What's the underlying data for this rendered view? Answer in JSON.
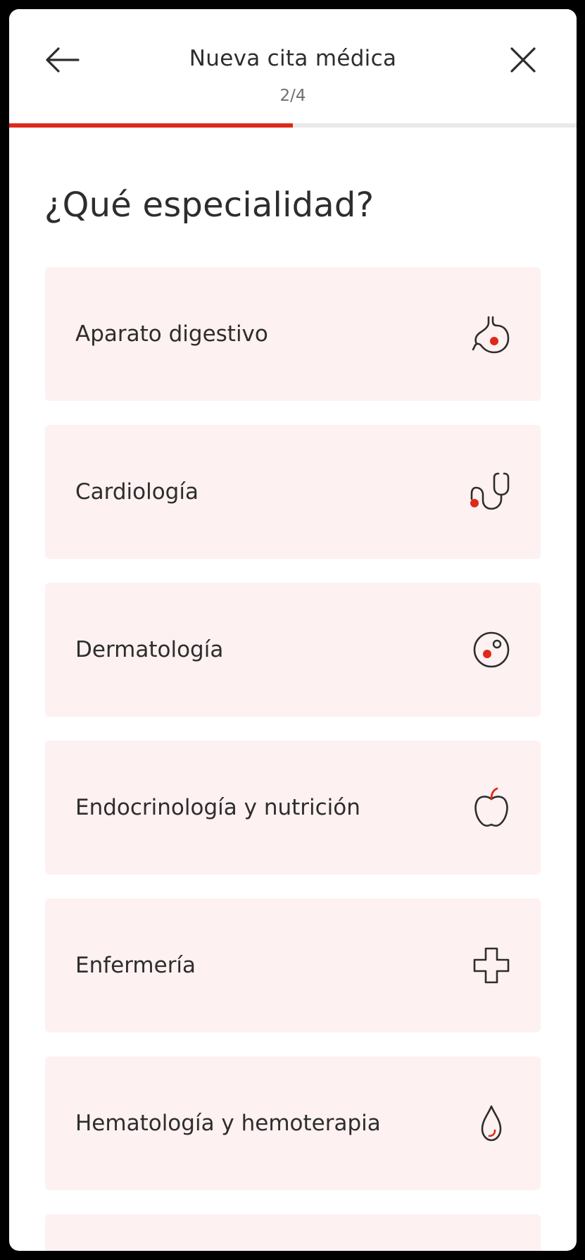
{
  "header": {
    "title": "Nueva cita médica",
    "step": "2/4",
    "progress": 0.5,
    "back_icon": "arrow-left-icon",
    "close_icon": "close-icon"
  },
  "question": "¿Qué especialidad?",
  "specialties": [
    {
      "label": "Aparato digestivo",
      "icon": "stomach-icon"
    },
    {
      "label": "Cardiología",
      "icon": "stethoscope-icon"
    },
    {
      "label": "Dermatología",
      "icon": "skin-spot-icon"
    },
    {
      "label": "Endocrinología y nutrición",
      "icon": "apple-icon"
    },
    {
      "label": "Enfermería",
      "icon": "cross-icon"
    },
    {
      "label": "Hematología y hemoterapia",
      "icon": "blood-drop-icon"
    }
  ],
  "colors": {
    "accent": "#dd2a1b",
    "card_background": "#fef1f1",
    "text": "#2d2d2d",
    "muted_text": "#6f6f6f",
    "icon_stroke": "#2d2d2d"
  }
}
